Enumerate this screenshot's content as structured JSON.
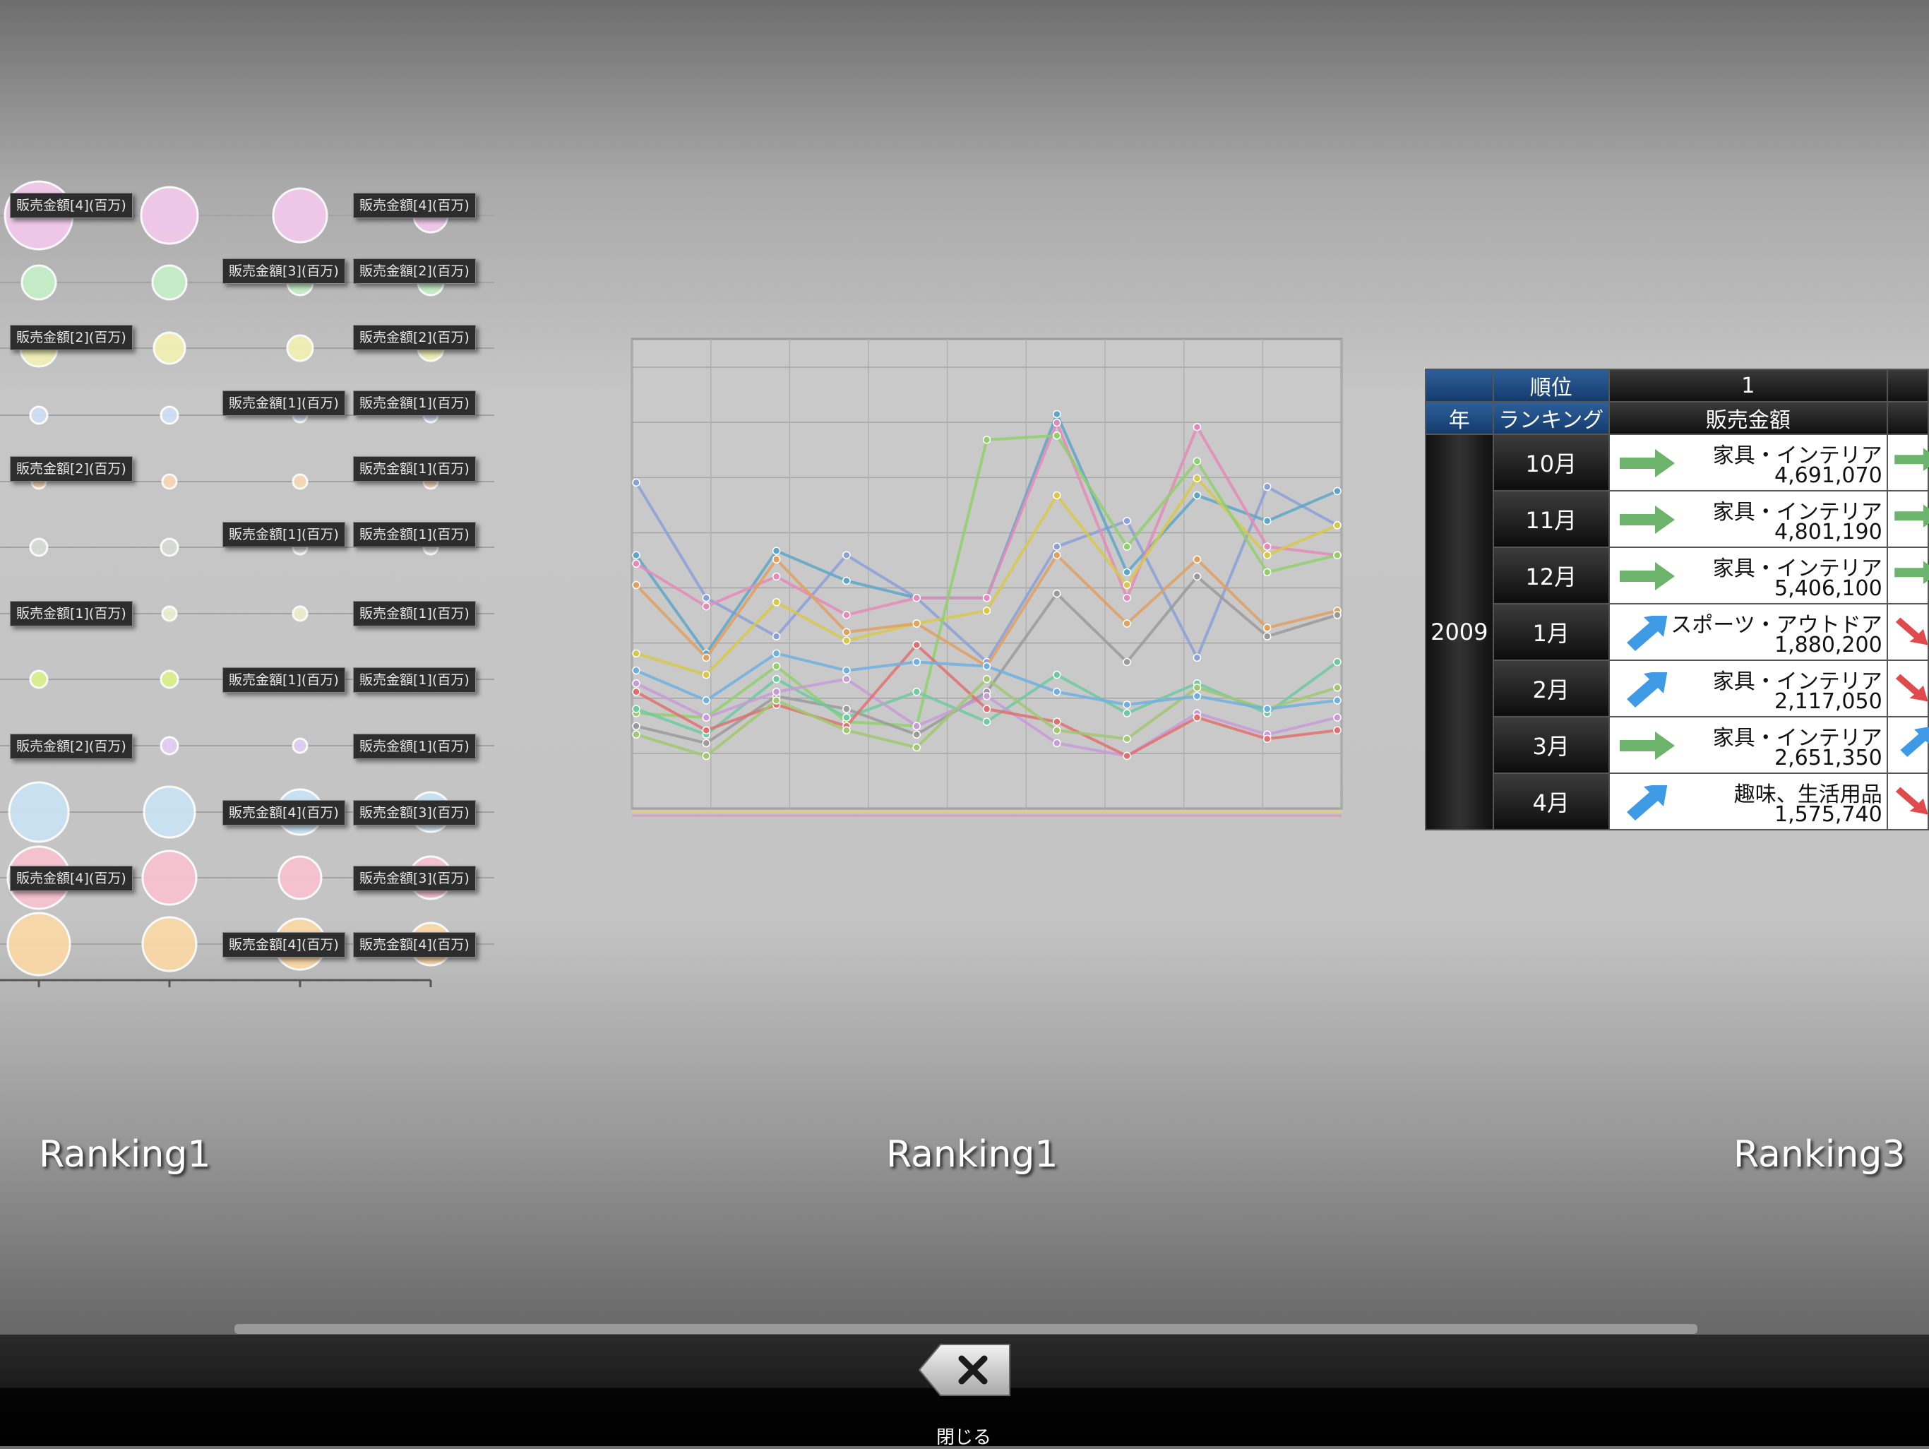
{
  "carousel": {
    "cards": [
      {
        "caption": "Ranking1"
      },
      {
        "caption": "Ranking1"
      },
      {
        "caption": "Ranking3"
      }
    ]
  },
  "bubble_chart": {
    "labels": [
      "販売金額[4](百万)",
      "販売金額[4](百万)",
      "販売金額[3](百万)",
      "販売金額[2](百万)",
      "販売金額[2](百万)",
      "販売金額[2](百万)",
      "販売金額[1](百万)",
      "販売金額[1](百万)",
      "販売金額[2](百万)",
      "販売金額[1](百万)",
      "販売金額[1](百万)",
      "販売金額[1](百万)",
      "販売金額[1](百万)",
      "販売金額[1](百万)",
      "販売金額[1](百万)",
      "販売金額[1](百万)",
      "販売金額[2](百万)",
      "販売金額[1](百万)",
      "販売金額[4](百万)",
      "販売金額[3](百万)",
      "販売金額[4](百万)",
      "販売金額[3](百万)",
      "販売金額[4](百万)",
      "販売金額[4](百万)"
    ],
    "row_colors": [
      "#f4c9ec",
      "#c4f0c8",
      "#f1f1b4",
      "#cfdff5",
      "#f9d8b3",
      "#d7ddd6",
      "#eeeecd",
      "#d9f18a",
      "#e2cdf5",
      "#c9e3f4",
      "#f7c2cf",
      "#fbd9a6"
    ]
  },
  "chart_data": {
    "type": "line",
    "title": "",
    "xlabel": "",
    "ylabel": "",
    "series_count": 12,
    "colors": [
      "#8aa0d8",
      "#5da6c8",
      "#e58ab8",
      "#d7c84a",
      "#8fd06a",
      "#e0a060",
      "#9a9a9a",
      "#6ec9a0",
      "#c89ad8",
      "#e07070",
      "#a0c870",
      "#70b0e0"
    ]
  },
  "ranking_table": {
    "header_rank_label": "順位",
    "header_rank_value": "1",
    "header_year_label": "年",
    "header_ranking_label": "ランキング",
    "header_metric_label": "販売金額",
    "year": "2009",
    "rows": [
      {
        "month": "10月",
        "trend": "flat",
        "category": "家具・インテリア",
        "amount": "4,691,070",
        "next_trend": "flat"
      },
      {
        "month": "11月",
        "trend": "flat",
        "category": "家具・インテリア",
        "amount": "4,801,190",
        "next_trend": "flat"
      },
      {
        "month": "12月",
        "trend": "flat",
        "category": "家具・インテリア",
        "amount": "5,406,100",
        "next_trend": "flat"
      },
      {
        "month": "1月",
        "trend": "up",
        "category": "スポーツ・アウトドア",
        "amount": "1,880,200",
        "next_trend": "down"
      },
      {
        "month": "2月",
        "trend": "up",
        "category": "家具・インテリア",
        "amount": "2,117,050",
        "next_trend": "down"
      },
      {
        "month": "3月",
        "trend": "flat",
        "category": "家具・インテリア",
        "amount": "2,651,350",
        "next_trend": "up"
      },
      {
        "month": "4月",
        "trend": "up",
        "category": "趣味、生活用品",
        "amount": "1,575,740",
        "next_trend": "down"
      }
    ],
    "colors": {
      "flat": "#6cb36c",
      "up": "#3f9ae6",
      "down": "#e04a4a"
    }
  },
  "toolbar": {
    "close_label": "閉じる",
    "close_icon": "close-icon"
  }
}
